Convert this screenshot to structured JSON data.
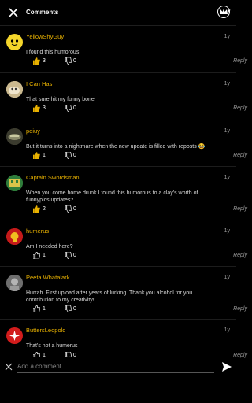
{
  "header": {
    "title": "Comments"
  },
  "comments": [
    {
      "user": "YellowShyGuy",
      "time": "1y",
      "text": "I found this humorous",
      "up": "3",
      "down": "0",
      "reply": "Reply"
    },
    {
      "user": "I Can Has",
      "time": "1y",
      "text": "That sure hit my funny bone",
      "up": "3",
      "down": "0",
      "reply": "Reply"
    },
    {
      "user": "poiuy",
      "time": "1y",
      "text": "But it turns into a nightmare when the new update is filled with reposts 😂",
      "up": "1",
      "down": "0",
      "reply": "Reply"
    },
    {
      "user": "Captain Swordsman",
      "time": "1y",
      "text": "When you come home drunk I found this humorous to a clay's worth of funnypics updates?",
      "up": "2",
      "down": "0",
      "reply": "Reply"
    },
    {
      "user": "humerus",
      "time": "1y",
      "text": "Am I needed here?",
      "up": "1",
      "down": "0",
      "reply": "Reply"
    },
    {
      "user": "Peeta Whatalark",
      "time": "1y",
      "text": "Hurrah. First upload after years of lurking. Thank you alcohol for you contribution to my creativity!",
      "up": "1",
      "down": "0",
      "reply": "Reply"
    },
    {
      "user": "ButtersLeopold",
      "time": "1y",
      "text": "That's not a humerus",
      "up": "1",
      "down": "0",
      "reply": "Reply"
    }
  ],
  "footer": {
    "placeholder": "Add a comment"
  },
  "colors": {
    "accent": "#e8b100",
    "background": "#000000"
  }
}
